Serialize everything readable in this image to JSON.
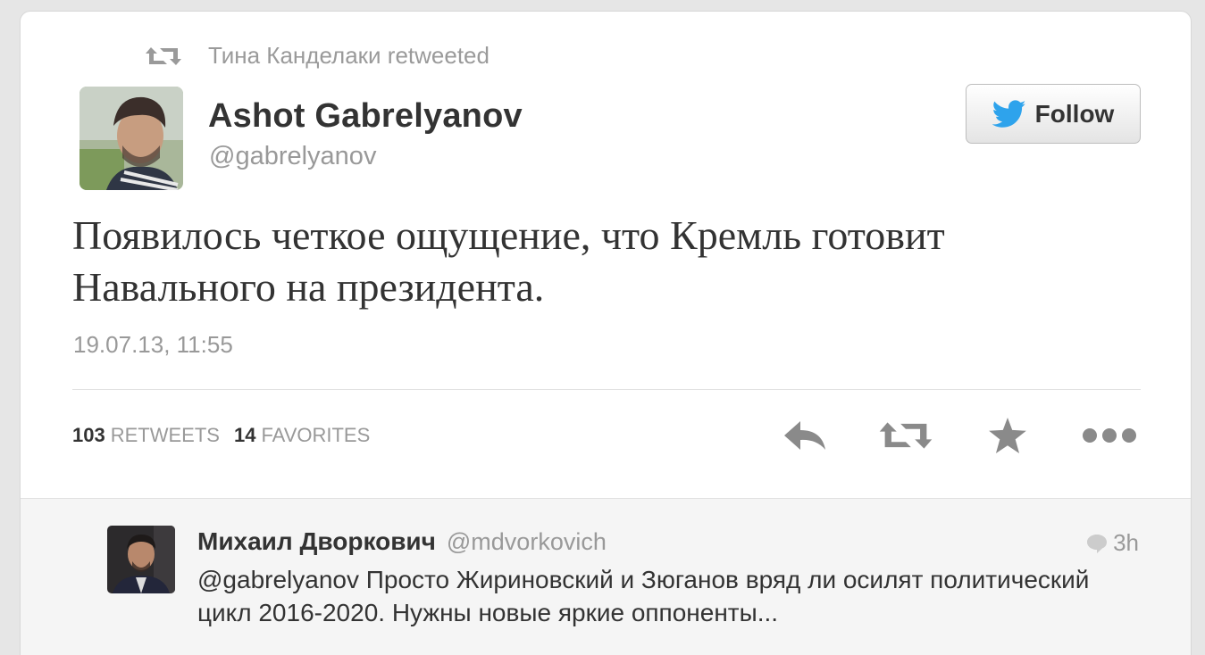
{
  "retweet_context": {
    "text": "Тина Канделаки retweeted",
    "icon": "retweet-icon"
  },
  "author": {
    "name": "Ashot Gabrelyanov",
    "handle": "@gabrelyanov",
    "avatar": "avatar-photo"
  },
  "follow_button": {
    "label": "Follow",
    "icon": "twitter-bird-icon"
  },
  "tweet": {
    "text": "Появилось четкое ощущение, что Кремль готовит Навального на президента.",
    "timestamp": "19.07.13, 11:55"
  },
  "stats": {
    "retweets_count": "103",
    "retweets_label": "RETWEETS",
    "favorites_count": "14",
    "favorites_label": "FAVORITES"
  },
  "actions": [
    {
      "name": "reply",
      "icon": "reply-icon"
    },
    {
      "name": "retweet",
      "icon": "retweet-icon"
    },
    {
      "name": "favorite",
      "icon": "star-icon"
    },
    {
      "name": "more",
      "icon": "more-dots-icon"
    }
  ],
  "reply": {
    "name": "Михаил Дворкович",
    "handle": "@mdvorkovich",
    "time": "3h",
    "text": "@gabrelyanov Просто Жириновский и Зюганов вряд ли осилят политический цикл 2016-2020. Нужны новые яркие оппоненты..."
  },
  "colors": {
    "text_primary": "#333333",
    "text_secondary": "#999999",
    "twitter_blue": "#2ea3ec",
    "icon_gray": "#8a8a8a"
  }
}
